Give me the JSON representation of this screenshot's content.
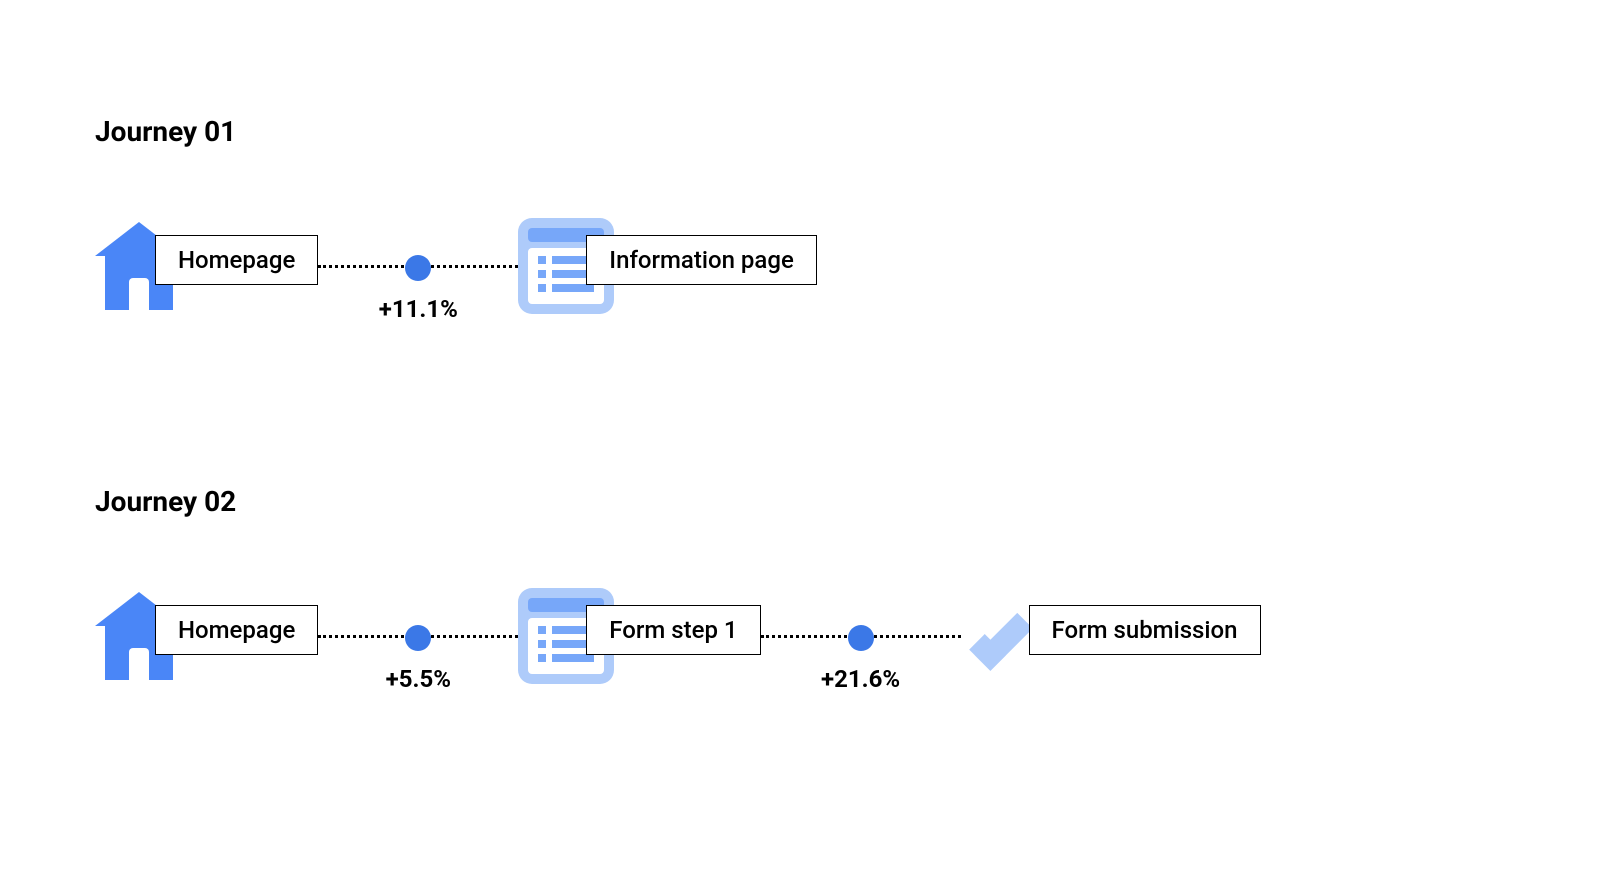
{
  "journeys": [
    {
      "title": "Journey 01",
      "nodes": [
        {
          "icon": "home",
          "label": "Homepage"
        },
        {
          "icon": "list",
          "label": "Information page"
        }
      ],
      "connectors": [
        {
          "pct": "+11.1%"
        }
      ]
    },
    {
      "title": "Journey 02",
      "nodes": [
        {
          "icon": "home",
          "label": "Homepage"
        },
        {
          "icon": "list",
          "label": "Form step 1"
        },
        {
          "icon": "check",
          "label": "Form submission"
        }
      ],
      "connectors": [
        {
          "pct": "+5.5%"
        },
        {
          "pct": "+21.6%"
        }
      ]
    }
  ],
  "colors": {
    "primary": "#4a86f7",
    "light": "#aecbfa",
    "mid": "#77a7f9",
    "dot": "#3b78e7"
  }
}
